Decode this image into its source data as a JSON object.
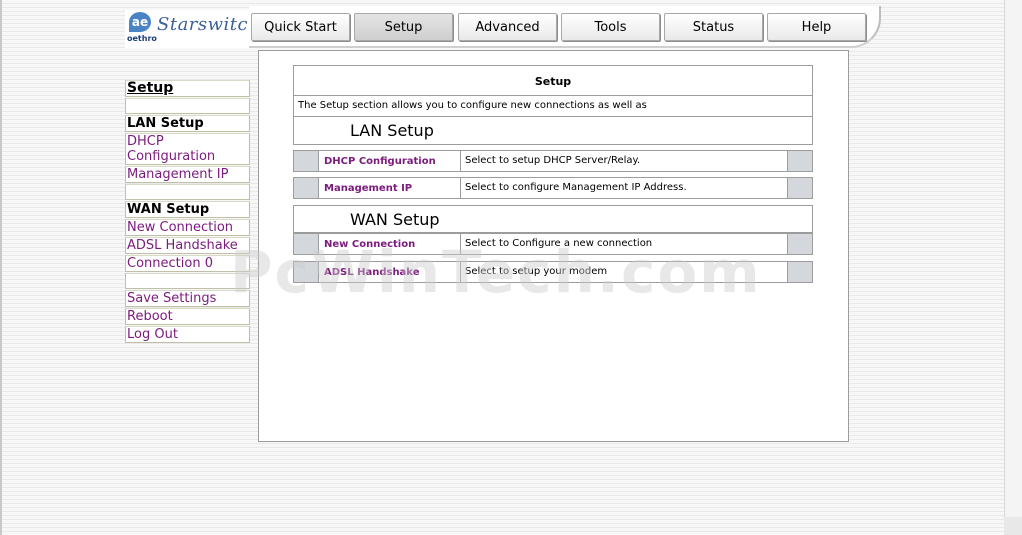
{
  "logo": {
    "brand": "oethro",
    "script": "Starswitch",
    "mark": "ae"
  },
  "nav": {
    "tabs": [
      {
        "label": "Quick Start",
        "active": false
      },
      {
        "label": "Setup",
        "active": true
      },
      {
        "label": "Advanced",
        "active": false
      },
      {
        "label": "Tools",
        "active": false
      },
      {
        "label": "Status",
        "active": false
      },
      {
        "label": "Help",
        "active": false
      }
    ]
  },
  "sidebar": {
    "title": "Setup",
    "lan_heading": "LAN Setup",
    "lan_items": [
      "DHCP Configuration",
      "Management IP"
    ],
    "wan_heading": "WAN Setup",
    "wan_items": [
      "New Connection",
      "ADSL Handshake",
      "Connection 0"
    ],
    "actions": [
      "Save Settings",
      "Reboot",
      "Log Out"
    ]
  },
  "content": {
    "title": "Setup",
    "description": "The Setup section allows you to configure new connections as well as",
    "lan": {
      "heading": "LAN Setup",
      "rows": [
        {
          "name": "DHCP Configuration",
          "desc": "Select to setup DHCP Server/Relay."
        },
        {
          "name": "Management IP",
          "desc": "Select to configure Management IP Address."
        }
      ]
    },
    "wan": {
      "heading": "WAN Setup",
      "rows": [
        {
          "name": "New Connection",
          "desc": "Select to Configure a new connection"
        },
        {
          "name": "ADSL Handshake",
          "desc": "Select to setup your modem"
        }
      ]
    }
  },
  "watermark": "PcWinTech.com",
  "colors": {
    "link": "#7b1b7d",
    "cap": "#d4d8dc",
    "border": "#9c9c9c"
  }
}
